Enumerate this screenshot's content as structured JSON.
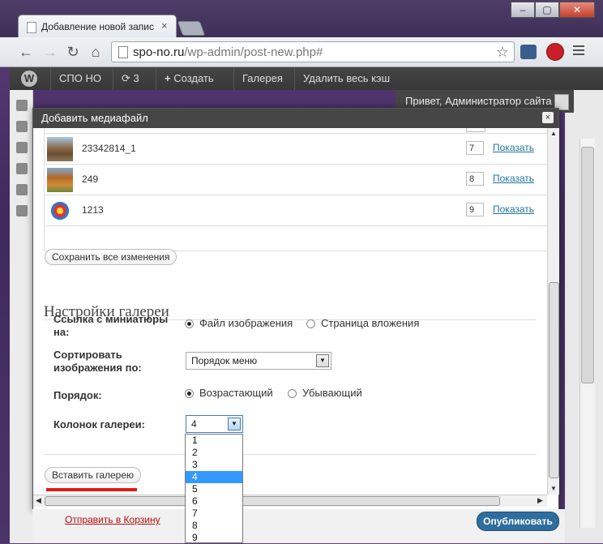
{
  "browser": {
    "tab_title": "Добавление новой запис",
    "tab_close": "×",
    "url_domain": "spo-no.ru",
    "url_path": "/wp-admin/post-new.php#",
    "window_buttons": {
      "minimize": "–",
      "maximize": "▢",
      "close": "✕"
    }
  },
  "adminbar": {
    "logo": "W",
    "site": "СПО НО",
    "updates_count": "3",
    "create": "Создать",
    "gallery": "Галерея",
    "clear_cache": "Удалить весь кэш",
    "greeting": "Привет, Администратор сайта"
  },
  "modal": {
    "title": "Добавить медиафайл",
    "close": "×",
    "media_items": [
      {
        "name": "23342814_1",
        "order": "7",
        "action": "Показать"
      },
      {
        "name": "249",
        "order": "8",
        "action": "Показать"
      },
      {
        "name": "1213",
        "order": "9",
        "action": "Показать"
      }
    ],
    "save_all": "Сохранить все изменения",
    "gallery_settings": {
      "title": "Настройки галереи",
      "link_label": "Ссылка с миниатюры на:",
      "link_options": [
        "Файл изображения",
        "Страница вложения"
      ],
      "link_selected": "Файл изображения",
      "sort_label": "Сортировать изображения по:",
      "sort_value": "Порядок меню",
      "order_label": "Порядок:",
      "order_options": [
        "Возрастающий",
        "Убывающий"
      ],
      "order_selected": "Возрастающий",
      "columns_label": "Колонок галереи:",
      "columns_value": "4",
      "columns_options": [
        "1",
        "2",
        "3",
        "4",
        "5",
        "6",
        "7",
        "8",
        "9"
      ]
    },
    "insert_gallery": "Вставить галерею"
  },
  "page_below": {
    "trash": "Отправить в Корзину",
    "publish": "Опубликовать"
  },
  "colors": {
    "link": "#21759b",
    "selected_option": "#3399ff",
    "highlight_underline": "#e21818"
  }
}
